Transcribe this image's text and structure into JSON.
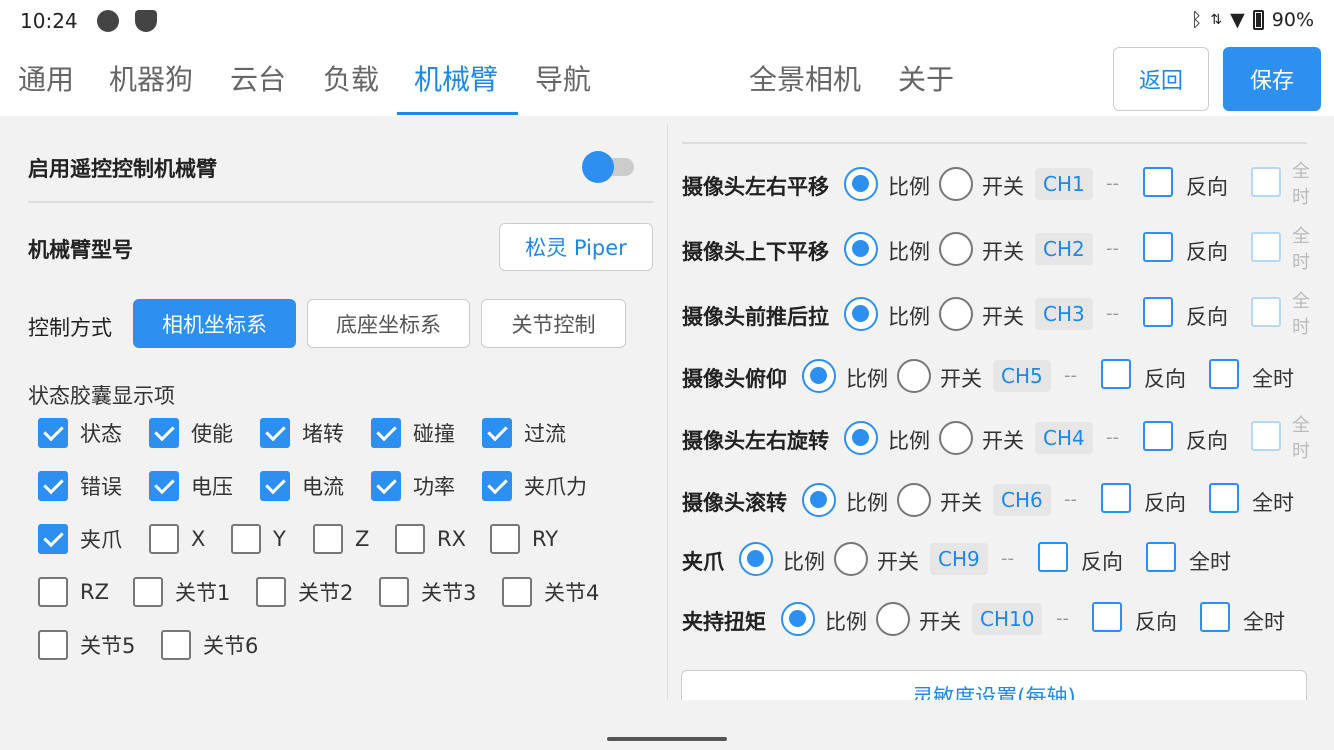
{
  "status_bar": {
    "time": "10:24",
    "battery": "90%"
  },
  "tabs": [
    "通用",
    "机器狗",
    "云台",
    "负载",
    "机械臂",
    "导航",
    "全景相机",
    "关于"
  ],
  "active_tab": "机械臂",
  "actions": {
    "back": "返回",
    "save": "保存"
  },
  "left": {
    "enable_label": "启用遥控控制机械臂",
    "enable_on": true,
    "model_label": "机械臂型号",
    "model_value": "松灵 Piper",
    "mode_label": "控制方式",
    "modes": [
      "相机坐标系",
      "底座坐标系",
      "关节控制"
    ],
    "active_mode": "相机坐标系",
    "caps_label": "状态胶囊显示项",
    "caps": [
      {
        "label": "状态",
        "checked": true
      },
      {
        "label": "使能",
        "checked": true
      },
      {
        "label": "堵转",
        "checked": true
      },
      {
        "label": "碰撞",
        "checked": true
      },
      {
        "label": "过流",
        "checked": true
      },
      {
        "label": "错误",
        "checked": true
      },
      {
        "label": "电压",
        "checked": true
      },
      {
        "label": "电流",
        "checked": true
      },
      {
        "label": "功率",
        "checked": true
      },
      {
        "label": "夹爪力",
        "checked": true
      },
      {
        "label": "夹爪",
        "checked": true
      },
      {
        "label": "X",
        "checked": false
      },
      {
        "label": "Y",
        "checked": false
      },
      {
        "label": "Z",
        "checked": false
      },
      {
        "label": "RX",
        "checked": false
      },
      {
        "label": "RY",
        "checked": false
      },
      {
        "label": "RZ",
        "checked": false
      },
      {
        "label": "关节1",
        "checked": false
      },
      {
        "label": "关节2",
        "checked": false
      },
      {
        "label": "关节3",
        "checked": false
      },
      {
        "label": "关节4",
        "checked": false
      },
      {
        "label": "关节5",
        "checked": false
      },
      {
        "label": "关节6",
        "checked": false
      }
    ]
  },
  "right": {
    "opt_ratio": "比例",
    "opt_switch": "开关",
    "dash": "--",
    "reverse": "反向",
    "always": "全时",
    "always_cut": "全\n时",
    "rows": [
      {
        "label": "摄像头左右平移",
        "channel": "CH1"
      },
      {
        "label": "摄像头上下平移",
        "channel": "CH2"
      },
      {
        "label": "摄像头前推后拉",
        "channel": "CH3"
      },
      {
        "label": "摄像头俯仰",
        "channel": "CH5"
      },
      {
        "label": "摄像头左右旋转",
        "channel": "CH4"
      },
      {
        "label": "摄像头滚转",
        "channel": "CH6"
      },
      {
        "label": "夹爪",
        "channel": "CH9"
      },
      {
        "label": "夹持扭矩",
        "channel": "CH10"
      }
    ],
    "sensitivity_button": "灵敏度设置(每轴)"
  }
}
